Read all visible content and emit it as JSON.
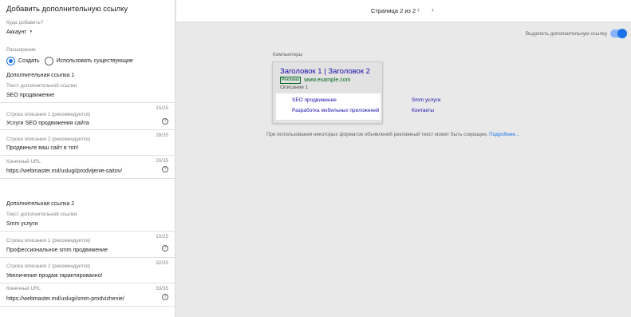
{
  "left": {
    "title": "Добавить дополнительную ссылку",
    "where_label": "Куда добавить?",
    "where_value": "Аккаунт",
    "extension_label": "Расширение",
    "radio_create": "Создать",
    "radio_existing": "Использовать существующие",
    "links": [
      {
        "heading": "Дополнительная ссылка 1",
        "text_label": "Текст дополнительной ссылки",
        "text_value": "SEO продвижение",
        "desc1_label": "Строка описания 1 (рекомендуется)",
        "desc1_count": "15/25",
        "desc1_value": "Услуги SEO продвижения сайта",
        "desc2_label": "Строка описания 2 (рекомендуется)",
        "desc2_count": "28/35",
        "desc2_value": "Продвиньте ваш сайт в топ!",
        "url_label": "Конечный URL",
        "url_count": "26/35",
        "url_value": "https://webmaster.md/uslugi/prodvijenie-saitov/"
      },
      {
        "heading": "Дополнительная ссылка 2",
        "text_label": "Текст дополнительной ссылки",
        "text_value": "Smm услуги",
        "desc1_label": "Строка описания 1 (рекомендуется)",
        "desc1_count": "10/25",
        "desc1_value": "Профессиональное smm продвижение",
        "desc2_label": "Строка описания 2 (рекомендуется)",
        "desc2_count": "32/35",
        "desc2_value": "Увеличение продаж гарантированно!",
        "url_label": "Конечный URL",
        "url_count": "33/35",
        "url_value": "https://webmaster.md/uslugi/smm-prodvizhenie/"
      }
    ]
  },
  "topbar": {
    "page_indicator": "Страница 2 из 2",
    "prev": "‹",
    "next": "›"
  },
  "toggle_label": "Выделить дополнительную ссылку",
  "device_label": "Компьютеры",
  "ad": {
    "title": "Заголовок 1 | Заголовок 2",
    "badge": "Реклама",
    "url": "www.example.com",
    "description": "Описание 1",
    "sitelinks": [
      "SEO продвижение",
      "Smm услуги",
      "Разработка мобильных приложений",
      "Контакты"
    ]
  },
  "notice": {
    "text": "При использовании некоторых форматов объявлений рекламный текст может быть сокращен. ",
    "link": "Подробнее..."
  },
  "colors": {
    "accent": "#1a73e8",
    "ad_title": "#1a0dab",
    "ad_url": "#006621"
  }
}
